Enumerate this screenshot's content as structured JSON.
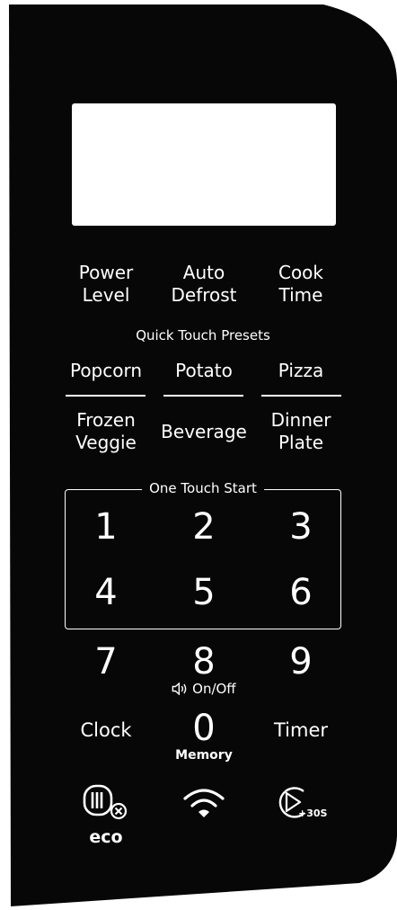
{
  "colors": {
    "panel": "#070707",
    "text": "#ffffff",
    "display": "#ffffff"
  },
  "top_buttons": {
    "power_level": "Power\nLevel",
    "auto_defrost": "Auto\nDefrost",
    "cook_time": "Cook\nTime"
  },
  "quick_touch": {
    "title": "Quick Touch Presets",
    "popcorn": "Popcorn",
    "potato": "Potato",
    "pizza": "Pizza",
    "frozen_veggie": "Frozen\nVeggie",
    "beverage": "Beverage",
    "dinner_plate": "Dinner\nPlate"
  },
  "one_touch": {
    "title": "One Touch Start",
    "keys": [
      "1",
      "2",
      "3",
      "4",
      "5",
      "6"
    ]
  },
  "keypad": {
    "k7": "7",
    "k8": "8",
    "k9": "9",
    "k0": "0",
    "sound_label": "On/Off",
    "memory_label": "Memory",
    "clock": "Clock",
    "timer": "Timer"
  },
  "bottom": {
    "eco_label": "eco",
    "plus30_label": "+30S",
    "icons": [
      "eco-door-icon",
      "wifi-icon",
      "start-plus30-icon"
    ]
  }
}
